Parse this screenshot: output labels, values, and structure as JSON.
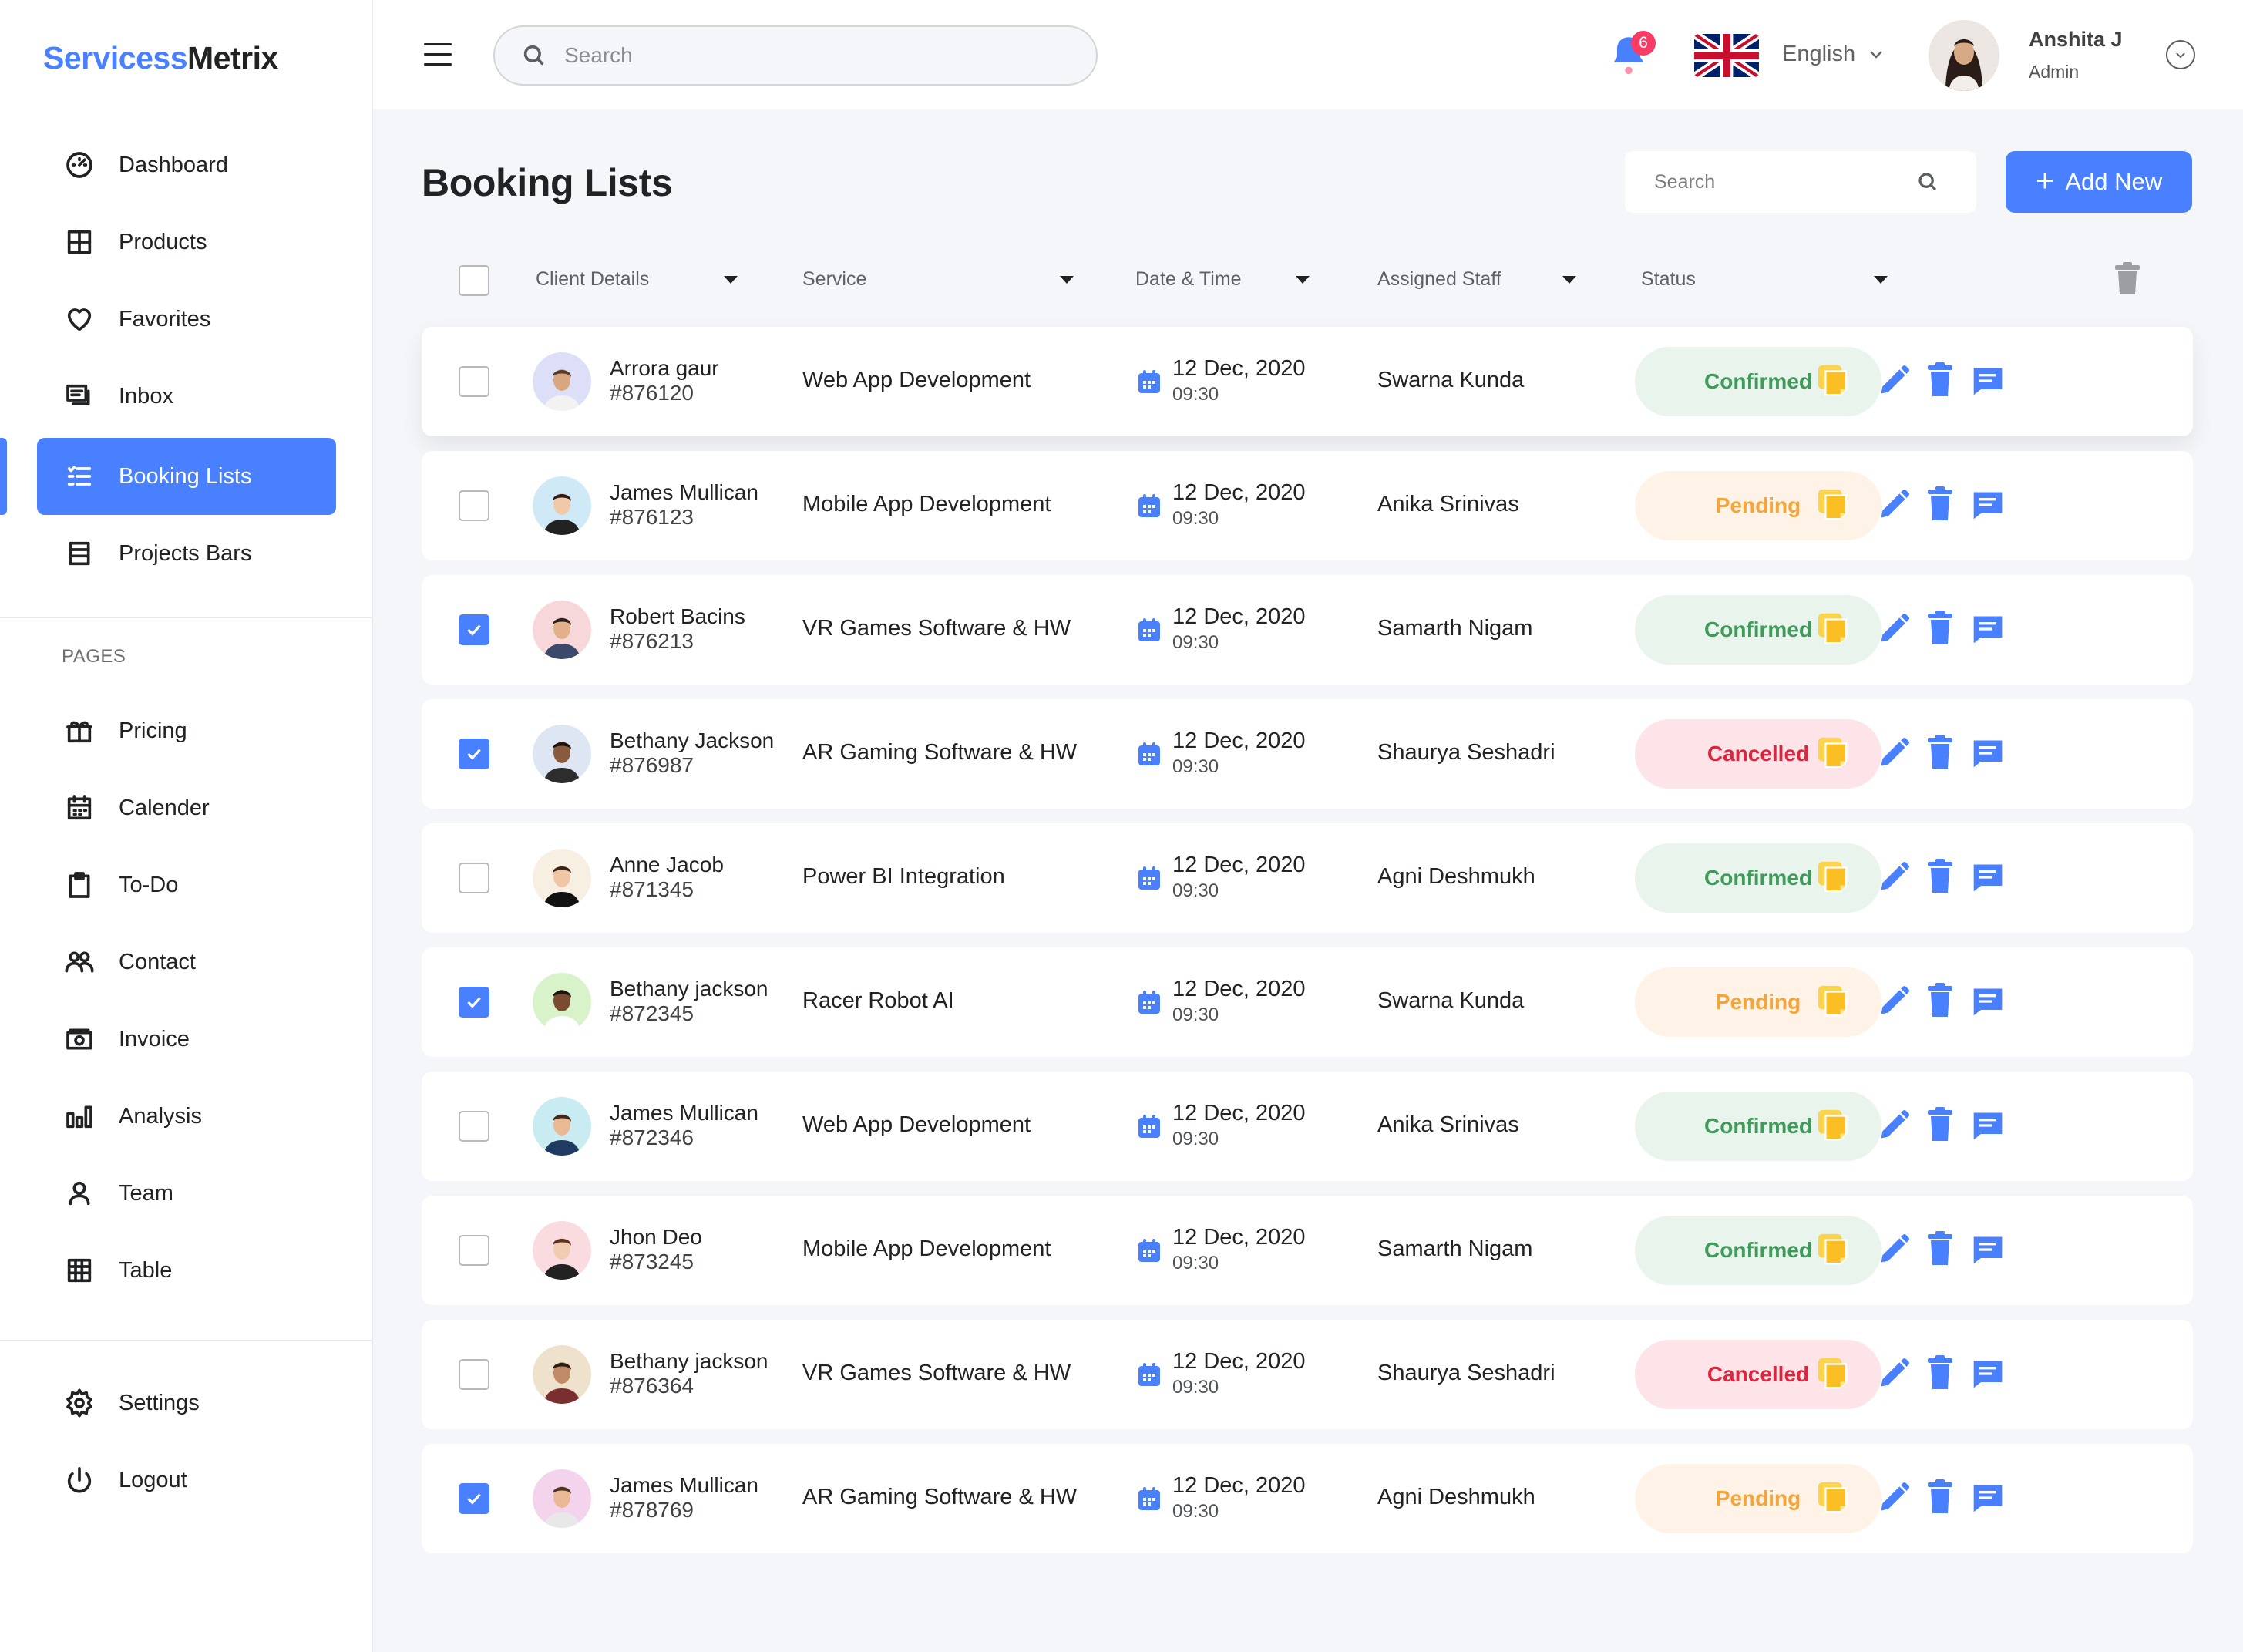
{
  "brand": {
    "part1": "Servicess",
    "part2": "Metrix",
    "color_accent": "#4880ff"
  },
  "sidebar": {
    "main": [
      {
        "label": "Dashboard",
        "icon": "dashboard-icon"
      },
      {
        "label": "Products",
        "icon": "grid-icon"
      },
      {
        "label": "Favorites",
        "icon": "heart-icon"
      },
      {
        "label": "Inbox",
        "icon": "inbox-icon"
      },
      {
        "label": "Booking Lists",
        "icon": "list-icon",
        "active": true
      },
      {
        "label": "Projects Bars",
        "icon": "stack-icon"
      }
    ],
    "pages_title": "PAGES",
    "pages": [
      {
        "label": "Pricing",
        "icon": "gift-icon"
      },
      {
        "label": "Calender",
        "icon": "calendar-icon"
      },
      {
        "label": "To-Do",
        "icon": "clipboard-icon"
      },
      {
        "label": "Contact",
        "icon": "contacts-icon"
      },
      {
        "label": "Invoice",
        "icon": "invoice-icon"
      },
      {
        "label": "Analysis",
        "icon": "bar-chart-icon"
      },
      {
        "label": "Team",
        "icon": "user-icon"
      },
      {
        "label": "Table",
        "icon": "table-icon"
      }
    ],
    "bottom": [
      {
        "label": "Settings",
        "icon": "gear-icon"
      },
      {
        "label": "Logout",
        "icon": "power-icon"
      }
    ]
  },
  "topbar": {
    "search_placeholder": "Search",
    "notifications_count": "6",
    "language": "English",
    "user_name": "Anshita J",
    "user_role": "Admin"
  },
  "main": {
    "title": "Booking Lists",
    "search_placeholder": "Search",
    "add_button": "Add New",
    "columns": [
      "Client Details",
      "Service",
      "Date & Time",
      "Assigned Staff",
      "Status"
    ]
  },
  "status_colors": {
    "Confirmed": "#3e9b5a",
    "Pending": "#f3a43b",
    "Cancelled": "#e0243e"
  },
  "rows": [
    {
      "checked": false,
      "name": "Arrora gaur",
      "id": "#876120",
      "service": "Web App Development",
      "date": "12 Dec, 2020",
      "time": "09:30",
      "staff": "Swarna Kunda",
      "status": "Confirmed"
    },
    {
      "checked": false,
      "name": "James Mullican",
      "id": "#876123",
      "service": "Mobile App Development",
      "date": "12 Dec, 2020",
      "time": "09:30",
      "staff": "Anika Srinivas",
      "status": "Pending"
    },
    {
      "checked": true,
      "name": "Robert Bacins",
      "id": "#876213",
      "service": "VR Games Software & HW",
      "date": "12 Dec, 2020",
      "time": "09:30",
      "staff": "Samarth Nigam",
      "status": "Confirmed"
    },
    {
      "checked": true,
      "name": "Bethany Jackson",
      "id": "#876987",
      "service": "AR Gaming Software & HW",
      "date": "12 Dec, 2020",
      "time": "09:30",
      "staff": "Shaurya Seshadri",
      "status": "Cancelled"
    },
    {
      "checked": false,
      "name": "Anne Jacob",
      "id": "#871345",
      "service": "Power BI Integration",
      "date": "12 Dec, 2020",
      "time": "09:30",
      "staff": "Agni Deshmukh",
      "status": "Confirmed"
    },
    {
      "checked": true,
      "name": "Bethany jackson",
      "id": "#872345",
      "service": "Racer Robot AI",
      "date": "12 Dec, 2020",
      "time": "09:30",
      "staff": "Swarna Kunda",
      "status": "Pending"
    },
    {
      "checked": false,
      "name": "James Mullican",
      "id": "#872346",
      "service": "Web App Development",
      "date": "12 Dec, 2020",
      "time": "09:30",
      "staff": "Anika Srinivas",
      "status": "Confirmed"
    },
    {
      "checked": false,
      "name": "Jhon Deo",
      "id": "#873245",
      "service": "Mobile App Development",
      "date": "12 Dec, 2020",
      "time": "09:30",
      "staff": "Samarth Nigam",
      "status": "Confirmed"
    },
    {
      "checked": false,
      "name": "Bethany jackson",
      "id": "#876364",
      "service": "VR Games Software & HW",
      "date": "12 Dec, 2020",
      "time": "09:30",
      "staff": "Shaurya Seshadri",
      "status": "Cancelled"
    },
    {
      "checked": true,
      "name": "James Mullican",
      "id": "#878769",
      "service": "AR Gaming Software & HW",
      "date": "12 Dec, 2020",
      "time": "09:30",
      "staff": "Agni Deshmukh",
      "status": "Pending"
    }
  ]
}
